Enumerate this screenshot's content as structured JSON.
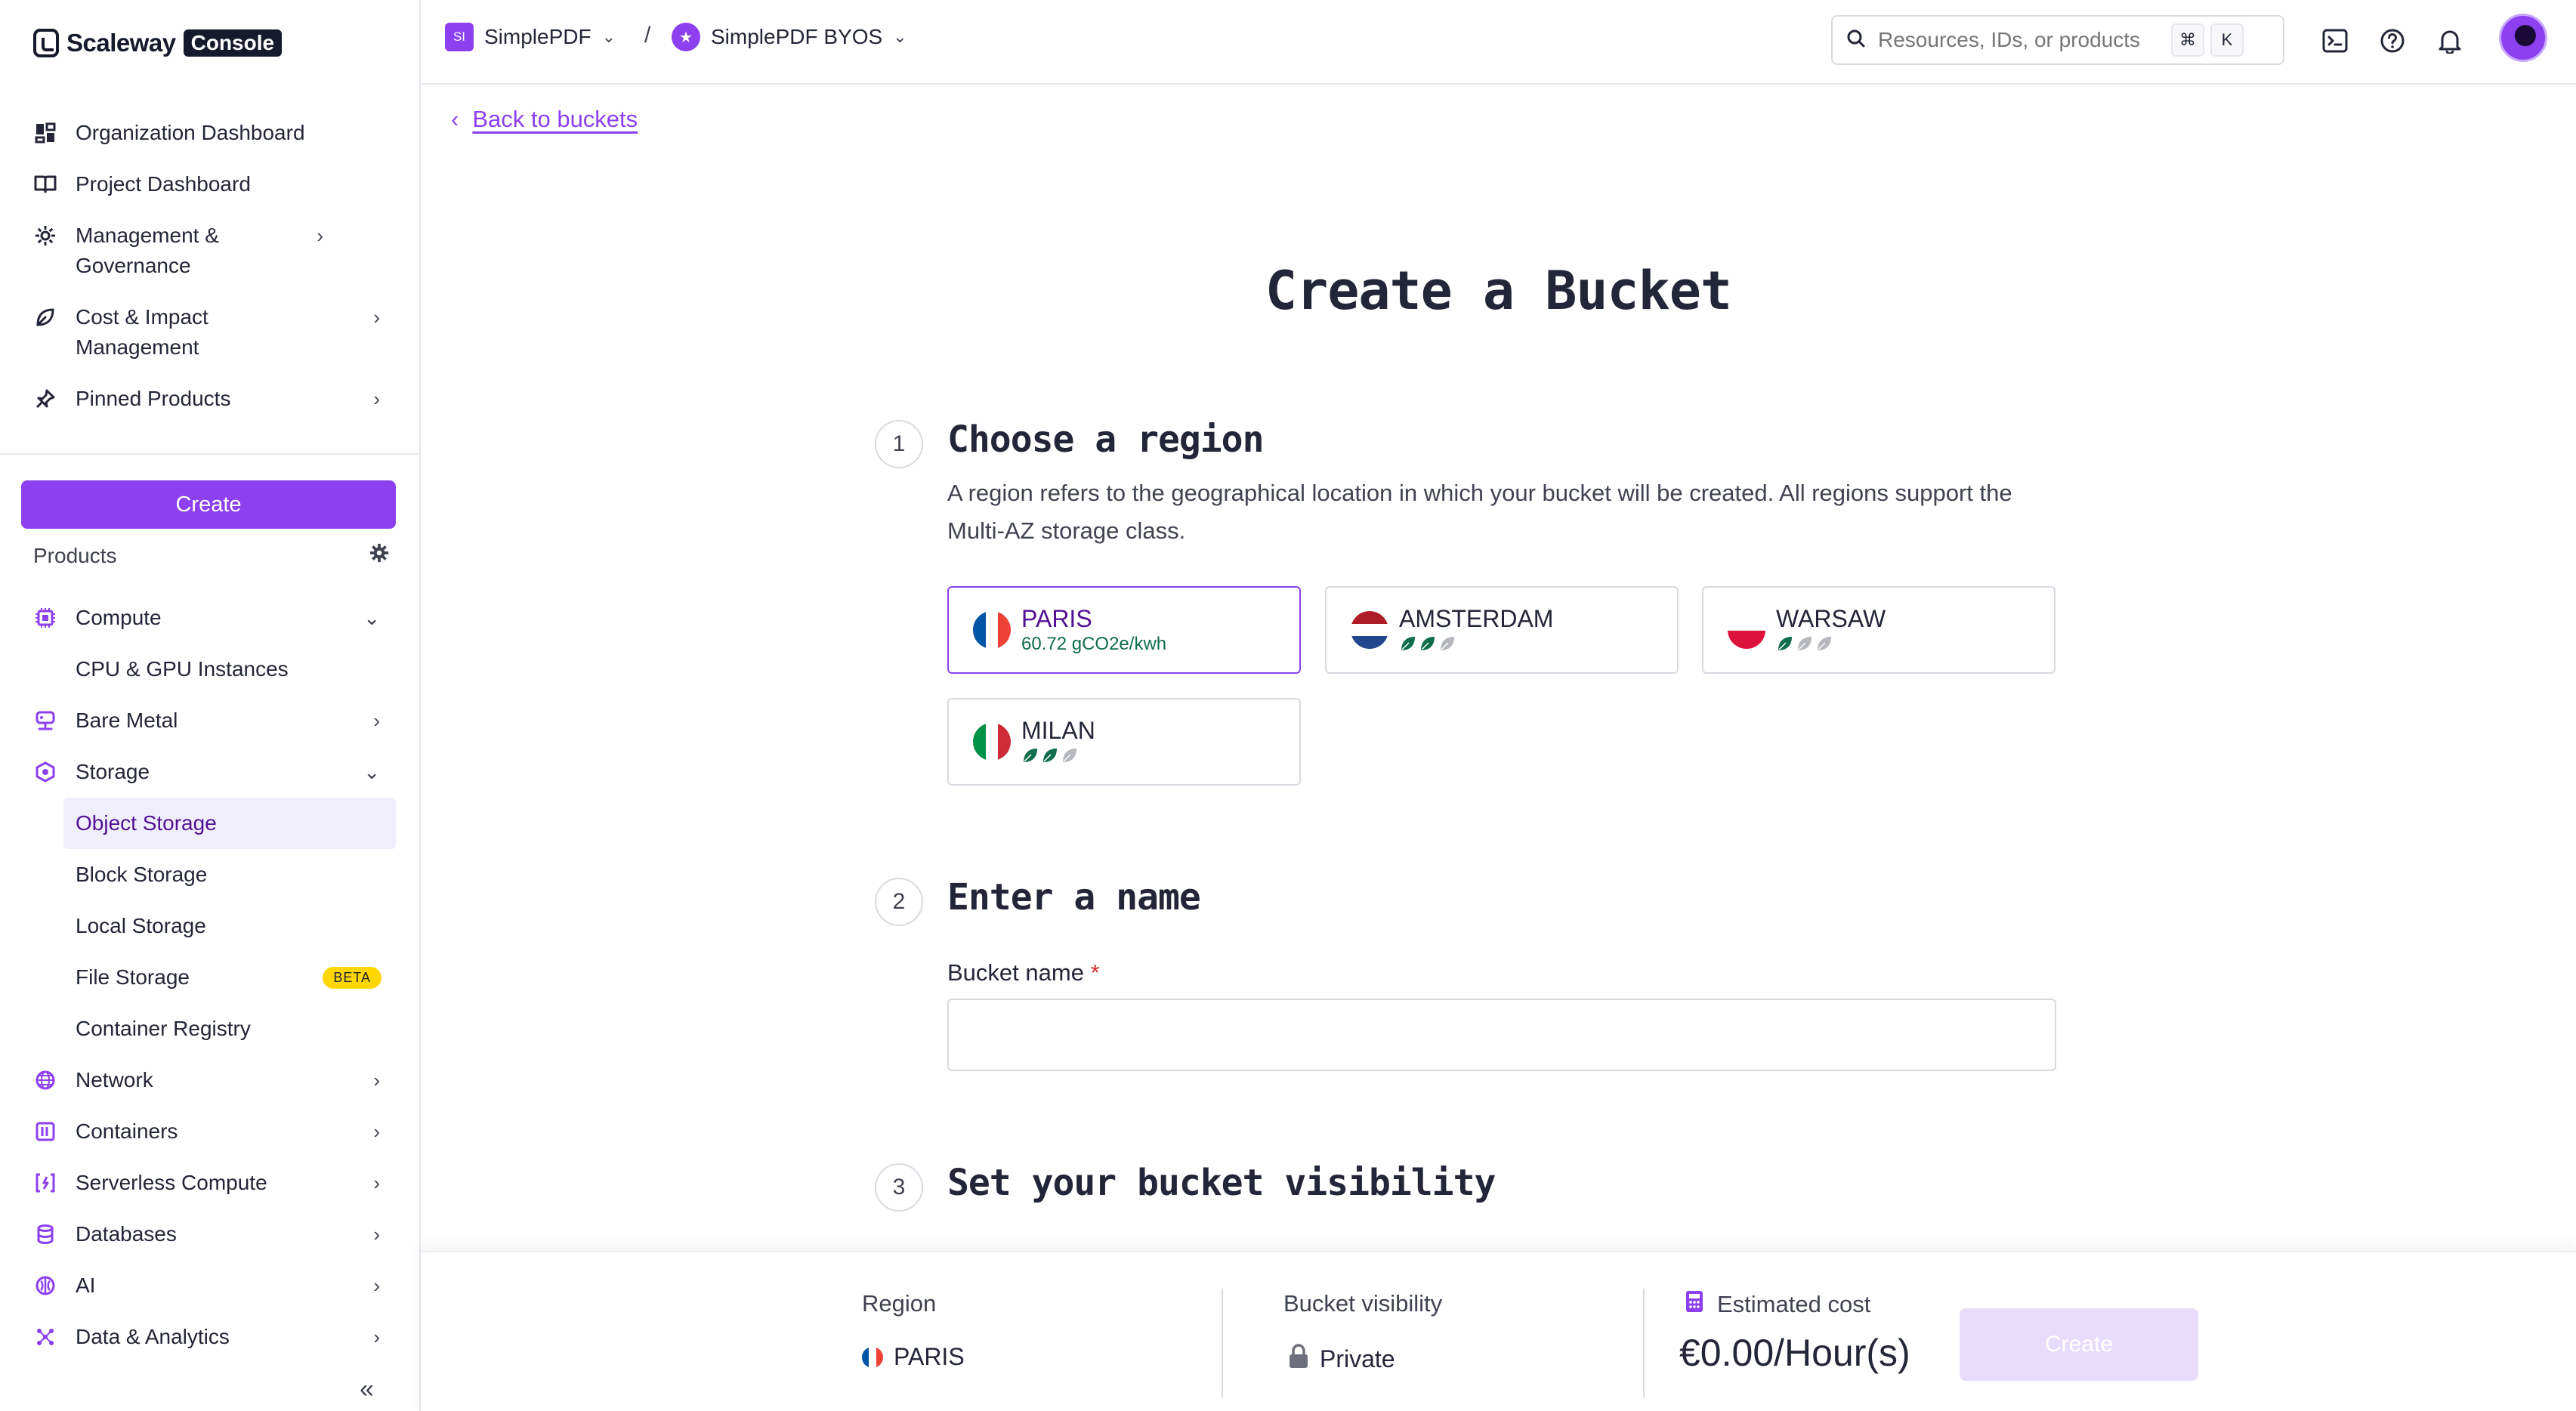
{
  "brand": {
    "name": "Scaleway",
    "badge": "Console"
  },
  "nav": {
    "organization_dashboard": "Organization Dashboard",
    "project_dashboard": "Project Dashboard",
    "management_governance": "Management & Governance",
    "cost_impact": "Cost & Impact Management",
    "pinned_products": "Pinned Products"
  },
  "sidebar": {
    "create_label": "Create",
    "products_label": "Products",
    "items": {
      "compute": "Compute",
      "cpu_gpu": "CPU & GPU Instances",
      "bare_metal": "Bare Metal",
      "storage": "Storage",
      "object_storage": "Object Storage",
      "block_storage": "Block Storage",
      "local_storage": "Local Storage",
      "file_storage": "File Storage",
      "file_storage_badge": "BETA",
      "container_registry": "Container Registry",
      "network": "Network",
      "containers": "Containers",
      "serverless": "Serverless Compute",
      "databases": "Databases",
      "ai": "AI",
      "data_analytics": "Data & Analytics"
    },
    "collapse_glyph": "«"
  },
  "topbar": {
    "org_initials": "SI",
    "org_name": "SimplePDF",
    "separator": "/",
    "project_name": "SimplePDF BYOS",
    "search_placeholder": "Resources, IDs, or products",
    "shortcut_cmd": "⌘",
    "shortcut_key": "K"
  },
  "main": {
    "back_label": "Back to buckets",
    "title": "Create a Bucket",
    "step1": {
      "number": "1",
      "title": "Choose a region",
      "description": "A region refers to the geographical location in which your bucket will be created. All regions support the Multi-AZ storage class."
    },
    "regions": [
      {
        "name": "PARIS",
        "sub": "60.72 gCO2e/kwh",
        "selected": true
      },
      {
        "name": "AMSTERDAM",
        "leaves_green": 2
      },
      {
        "name": "WARSAW",
        "leaves_green": 1
      },
      {
        "name": "MILAN",
        "leaves_green": 2
      }
    ],
    "step2": {
      "number": "2",
      "title": "Enter a name",
      "field_label": "Bucket name",
      "required_mark": "*",
      "value": ""
    },
    "step3": {
      "number": "3",
      "title": "Set your bucket visibility"
    }
  },
  "summary": {
    "region_label": "Region",
    "region_value": "PARIS",
    "visibility_label": "Bucket visibility",
    "visibility_value": "Private",
    "cost_label": "Estimated cost",
    "cost_value": "€0.00/Hour(s)",
    "create_label": "Create"
  },
  "colors": {
    "accent": "#8c40ef",
    "accent_dark": "#521094",
    "eco_green": "#0f6d4b"
  }
}
